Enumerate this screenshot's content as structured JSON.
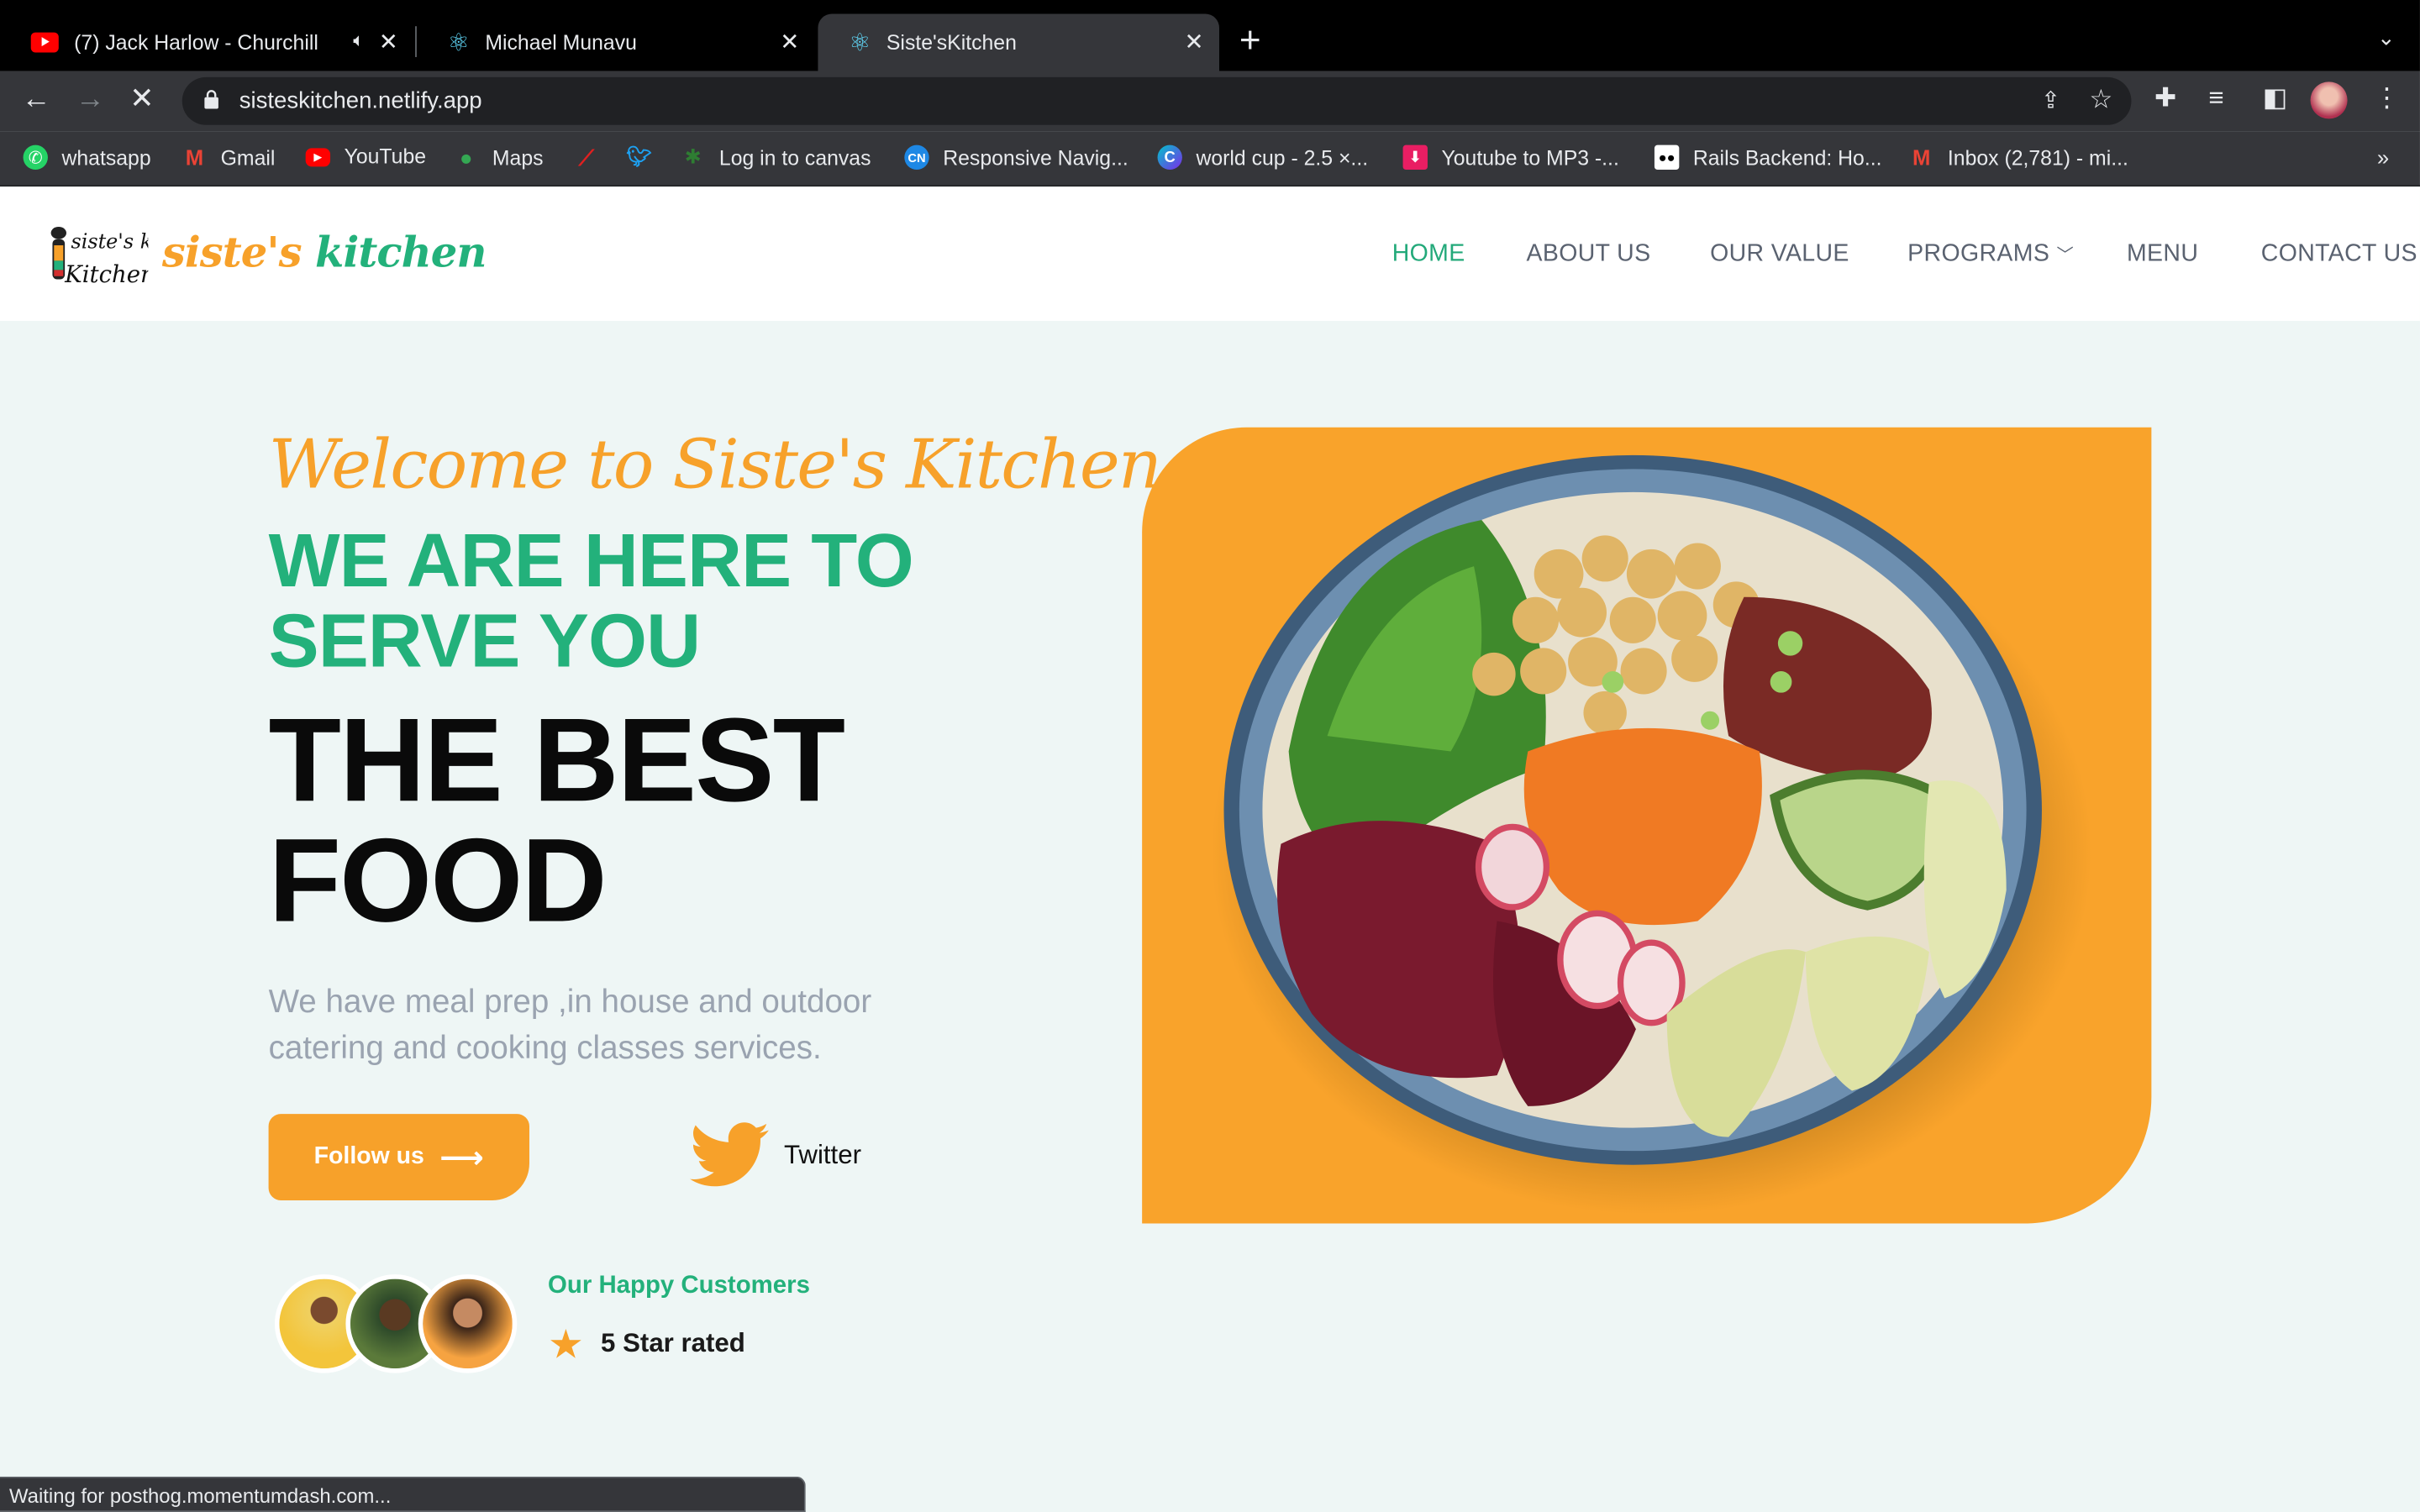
{
  "browser": {
    "tabs": [
      {
        "title": "(7) Jack Harlow - Churchill",
        "icon": "youtube-icon",
        "audio": "speaker-icon"
      },
      {
        "title": "Michael Munavu",
        "icon": "react-icon"
      },
      {
        "title": "Siste'sKitchen",
        "icon": "react-icon"
      }
    ],
    "url": "sisteskitchen.netlify.app",
    "bookmarks": [
      {
        "label": "whatsapp",
        "icon": "whatsapp-icon"
      },
      {
        "label": "Gmail",
        "icon": "gmail-icon"
      },
      {
        "label": "YouTube",
        "icon": "youtube-icon"
      },
      {
        "label": "Maps",
        "icon": "maps-icon"
      },
      {
        "label": "Log in to canvas",
        "icon": "canvas-icon"
      },
      {
        "label": "Responsive Navig...",
        "icon": "codepen-icon"
      },
      {
        "label": "world cup - 2.5 ×...",
        "icon": "canva-icon"
      },
      {
        "label": "Youtube to MP3 -...",
        "icon": "download-icon"
      },
      {
        "label": "Rails Backend: Ho...",
        "icon": "medium-icon"
      },
      {
        "label": "Inbox (2,781) - mi...",
        "icon": "gmail-icon"
      }
    ],
    "status": "Waiting for posthog.momentumdash.com..."
  },
  "site": {
    "logo_small": "siste's kitchen",
    "logo_word1": "siste's",
    "logo_word2": "kitchen",
    "nav": [
      "HOME",
      "ABOUT US",
      "OUR VALUE",
      "PROGRAMS",
      "MENU",
      "CONTACT US"
    ],
    "active_nav": "HOME"
  },
  "hero": {
    "welcome": "Welcome to Siste's Kitchen",
    "serve": "WE ARE HERE TO SERVE YOU",
    "best": "THE BEST FOOD",
    "desc": "We have meal prep ,in house and outdoor catering and cooking classes services.",
    "follow_label": "Follow us",
    "twitter_label": "Twitter",
    "customers_title": "Our Happy Customers",
    "rating_text": "5 Star rated"
  },
  "colors": {
    "brand_orange": "#f7a12a",
    "brand_green": "#23b17b",
    "page_bg": "#eef6f5",
    "twitter_orange": "#f7a12a"
  }
}
